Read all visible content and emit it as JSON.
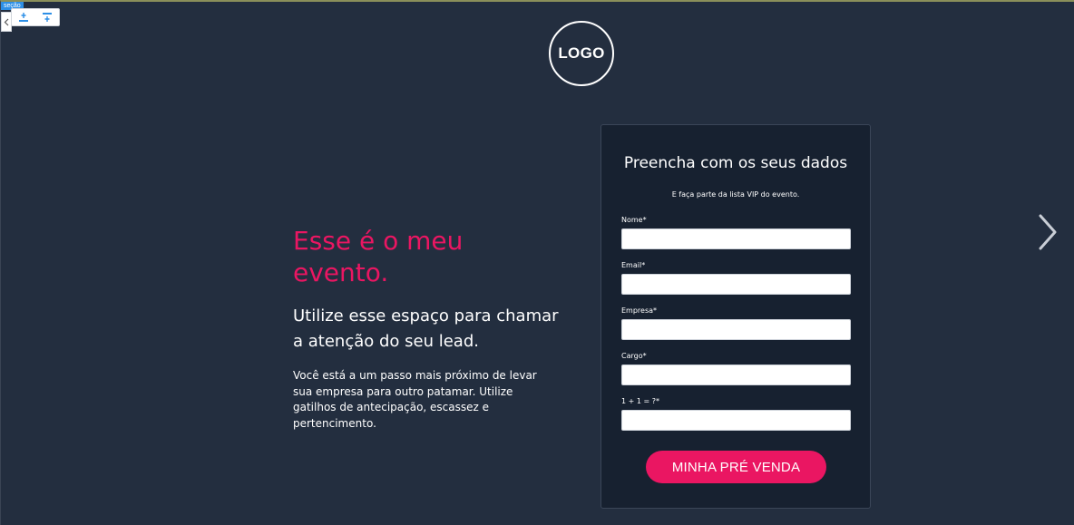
{
  "editor": {
    "section_tag": "seção"
  },
  "brand": {
    "logo_text": "LOGO"
  },
  "hero": {
    "headline": "Esse é o meu evento.",
    "subheadline": "Utilize esse espaço para chamar a atenção do seu lead.",
    "body": "Você está a um passo mais próximo de levar sua empresa para outro patamar. Utilize gatilhos de antecipação, escassez e pertencimento."
  },
  "form": {
    "title": "Preencha com os seus dados",
    "subtitle": "E faça parte da lista VIP do evento.",
    "fields": [
      {
        "label": "Nome*",
        "value": ""
      },
      {
        "label": "Email*",
        "value": ""
      },
      {
        "label": "Empresa*",
        "value": ""
      },
      {
        "label": "Cargo*",
        "value": ""
      },
      {
        "label": "1 + 1 = ?*",
        "value": ""
      }
    ],
    "submit_label": "MINHA PRÉ VENDA"
  },
  "colors": {
    "background": "#232e3f",
    "card": "#172130",
    "accent": "#ea1662",
    "text": "#ffffff"
  },
  "icons": {
    "toolbar": [
      "add-section-above-icon",
      "add-section-below-icon"
    ],
    "collapse": "chevron-left-icon",
    "next": "chevron-right-icon"
  }
}
